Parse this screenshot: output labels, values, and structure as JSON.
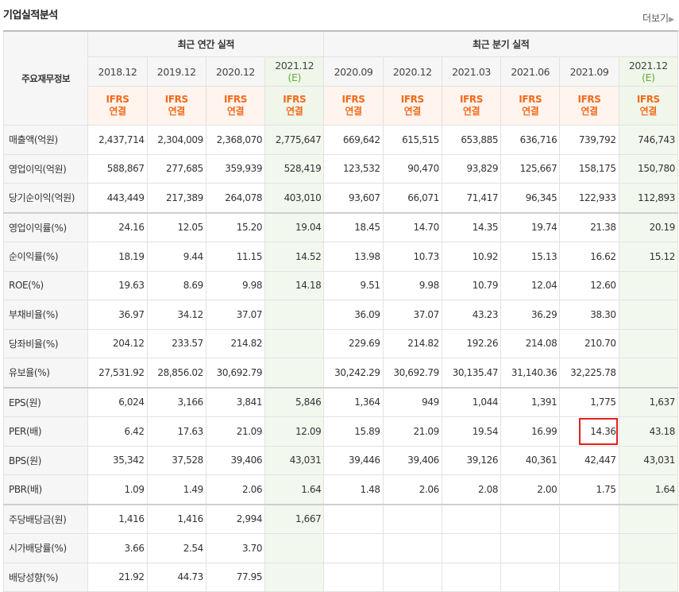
{
  "title": "기업실적분석",
  "more": {
    "label": "더보기",
    "arrow": "▶"
  },
  "header": {
    "stub": "주요재무정보",
    "groups": [
      "최근 연간 실적",
      "최근 분기 실적"
    ],
    "periods": [
      {
        "label": "2018.12",
        "est": ""
      },
      {
        "label": "2019.12",
        "est": ""
      },
      {
        "label": "2020.12",
        "est": ""
      },
      {
        "label": "2021.12",
        "est": "(E)"
      },
      {
        "label": "2020.09",
        "est": ""
      },
      {
        "label": "2020.12",
        "est": ""
      },
      {
        "label": "2021.03",
        "est": ""
      },
      {
        "label": "2021.06",
        "est": ""
      },
      {
        "label": "2021.09",
        "est": ""
      },
      {
        "label": "2021.12",
        "est": "(E)"
      }
    ],
    "ifrs_top": "IFRS",
    "ifrs_bottom": "연결"
  },
  "rows": [
    {
      "label": "매출액(억원)",
      "values": [
        "2,437,714",
        "2,304,009",
        "2,368,070",
        "2,775,647",
        "669,642",
        "615,515",
        "653,885",
        "636,716",
        "739,792",
        "746,743"
      ]
    },
    {
      "label": "영업이익(억원)",
      "values": [
        "588,867",
        "277,685",
        "359,939",
        "528,419",
        "123,532",
        "90,470",
        "93,829",
        "125,667",
        "158,175",
        "150,780"
      ]
    },
    {
      "label": "당기순이익(억원)",
      "values": [
        "443,449",
        "217,389",
        "264,078",
        "403,010",
        "93,607",
        "66,071",
        "71,417",
        "96,345",
        "122,933",
        "112,893"
      ]
    },
    {
      "label": "영업이익률(%)",
      "values": [
        "24.16",
        "12.05",
        "15.20",
        "19.04",
        "18.45",
        "14.70",
        "14.35",
        "19.74",
        "21.38",
        "20.19"
      ]
    },
    {
      "label": "순이익률(%)",
      "values": [
        "18.19",
        "9.44",
        "11.15",
        "14.52",
        "13.98",
        "10.73",
        "10.92",
        "15.13",
        "16.62",
        "15.12"
      ]
    },
    {
      "label": "ROE(%)",
      "values": [
        "19.63",
        "8.69",
        "9.98",
        "14.18",
        "9.51",
        "9.98",
        "10.79",
        "12.04",
        "12.60",
        ""
      ]
    },
    {
      "label": "부채비율(%)",
      "values": [
        "36.97",
        "34.12",
        "37.07",
        "",
        "36.09",
        "37.07",
        "43.23",
        "36.29",
        "38.30",
        ""
      ]
    },
    {
      "label": "당좌비율(%)",
      "values": [
        "204.12",
        "233.57",
        "214.82",
        "",
        "229.69",
        "214.82",
        "192.26",
        "214.08",
        "210.70",
        ""
      ]
    },
    {
      "label": "유보율(%)",
      "values": [
        "27,531.92",
        "28,856.02",
        "30,692.79",
        "",
        "30,242.29",
        "30,692.79",
        "30,135.47",
        "31,140.36",
        "32,225.78",
        ""
      ]
    },
    {
      "label": "EPS(원)",
      "values": [
        "6,024",
        "3,166",
        "3,841",
        "5,846",
        "1,364",
        "949",
        "1,044",
        "1,391",
        "1,775",
        "1,637"
      ]
    },
    {
      "label": "PER(배)",
      "values": [
        "6.42",
        "17.63",
        "21.09",
        "12.09",
        "15.89",
        "21.09",
        "19.54",
        "16.99",
        "14.36",
        "43.18"
      ]
    },
    {
      "label": "BPS(원)",
      "values": [
        "35,342",
        "37,528",
        "39,406",
        "43,031",
        "39,446",
        "39,406",
        "39,126",
        "40,361",
        "42,447",
        "43,031"
      ]
    },
    {
      "label": "PBR(배)",
      "values": [
        "1.09",
        "1.49",
        "2.06",
        "1.64",
        "1.48",
        "2.06",
        "2.08",
        "2.00",
        "1.75",
        "1.64"
      ]
    },
    {
      "label": "주당배당금(원)",
      "values": [
        "1,416",
        "1,416",
        "2,994",
        "1,667",
        "",
        "",
        "",
        "",
        "",
        ""
      ]
    },
    {
      "label": "시가배당률(%)",
      "values": [
        "3.66",
        "2.54",
        "3.70",
        "",
        "",
        "",
        "",
        "",
        "",
        ""
      ]
    },
    {
      "label": "배당성향(%)",
      "values": [
        "21.92",
        "44.73",
        "77.95",
        "",
        "",
        "",
        "",
        "",
        "",
        ""
      ]
    }
  ],
  "highlight": {
    "row": 10,
    "col": 8,
    "color": "#e3201b"
  }
}
